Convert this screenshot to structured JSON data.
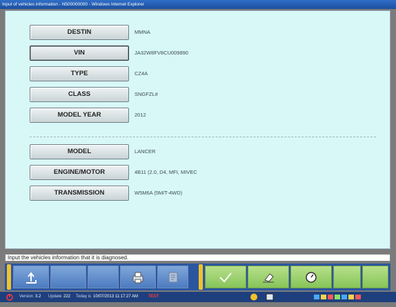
{
  "window": {
    "title": "Input of vehicles information - N500000000 - Windows Internet Explorer"
  },
  "fields": [
    {
      "label": "DESTIN",
      "value": "MMNA"
    },
    {
      "label": "VIN",
      "value": "JA32W8FV8CU009890"
    },
    {
      "label": "TYPE",
      "value": "CZ4A"
    },
    {
      "label": "CLASS",
      "value": "SNGFZL#"
    },
    {
      "label": "MODEL YEAR",
      "value": "2012"
    },
    {
      "label": "MODEL",
      "value": "LANCER"
    },
    {
      "label": "ENGINE/MOTOR",
      "value": "4B11 (2.0, D4, MFI, MIVEC"
    },
    {
      "label": "TRANSMISSION",
      "value": "W5M6A (5M/T-4WD)"
    }
  ],
  "status_message": "Input the vehicles information that it is diagnosed.",
  "toolbar": {
    "icons": [
      "back-up-arrow-icon",
      "print-icon",
      "memo-icon",
      "checkmark-icon",
      "eraser-icon",
      "clock-icon"
    ]
  },
  "footer": {
    "version_label": "Version",
    "version": "3.2",
    "update_label": "Update",
    "update": "222",
    "today_label": "Today is",
    "today": "10/07/2013 11:17:27 AM",
    "mode": "TEST"
  },
  "colors": {
    "content_bg": "#d8f8f8",
    "toolbar_blue": "#2a56a0",
    "toolbar_green": "#86c45a",
    "separator_yellow": "#f3c12c"
  }
}
